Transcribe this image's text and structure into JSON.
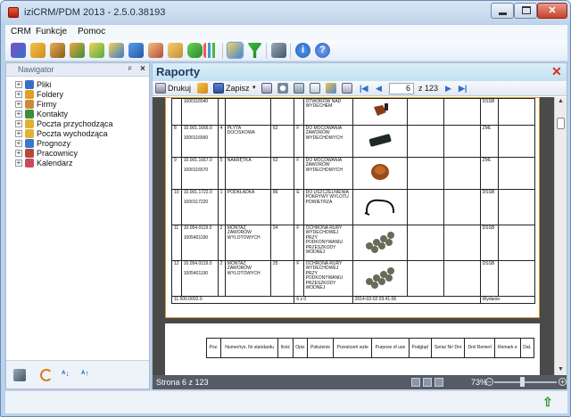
{
  "window": {
    "title": "iziCRM/PDM 2013 - 2.5.0.38193",
    "controls": {
      "minimize": "–",
      "maximize": "□",
      "close": "✕"
    }
  },
  "menu": [
    "CRM",
    "Funkcje",
    "Pomoc"
  ],
  "navigator": {
    "title": "Nawigator",
    "pin": "ᵖ",
    "close": "×",
    "items": [
      {
        "label": "Pliki",
        "icon": "files-icon",
        "color": "#3a6fc6"
      },
      {
        "label": "Foldery",
        "icon": "folder-icon",
        "color": "#e0a020"
      },
      {
        "label": "Firmy",
        "icon": "company-icon",
        "color": "#c98a3a"
      },
      {
        "label": "Kontakty",
        "icon": "contacts-icon",
        "color": "#3a8f3a"
      },
      {
        "label": "Poczta przychodząca",
        "icon": "inbox-icon",
        "color": "#e3b234"
      },
      {
        "label": "Poczta wychodząca",
        "icon": "outbox-icon",
        "color": "#e3b234"
      },
      {
        "label": "Prognozy",
        "icon": "forecast-icon",
        "color": "#3a78c9"
      },
      {
        "label": "Pracownicy",
        "icon": "employees-icon",
        "color": "#b34a3a"
      },
      {
        "label": "Kalendarz",
        "icon": "calendar-icon",
        "color": "#c94a5a"
      }
    ]
  },
  "report": {
    "title": "Raporty",
    "toolbar": {
      "print": "Drukuj",
      "save": "Zapisz",
      "page": "6",
      "of_pages": "z 123"
    },
    "status": "Strona 6 z 123",
    "zoom": "73%"
  },
  "report_table": {
    "rows": [
      {
        "lp": "",
        "nr": "1000116540",
        "qty": "",
        "name": "",
        "a": "",
        "b": "",
        "desc": "OTWORÓW NAD WYDECHEM",
        "img": "part-1",
        "status": "DSSB"
      },
      {
        "lp": "8",
        "nr": "10.001.1666.0\n\n1000116560",
        "qty": "4",
        "name": "PŁYTA DOCISKOWA",
        "a": "62",
        "b": "F",
        "desc": "DO MOCOWANIA ZAWORÓW WYDECHOWYCH",
        "img": "part-2",
        "status": "ZML"
      },
      {
        "lp": "9",
        "nr": "10.001.1667.0\n\n1000116570",
        "qty": "5",
        "name": "NAKRĘTKA",
        "a": "62",
        "b": "F",
        "desc": "DO MOCOWANIA ZAWORÓW WYDECHOWYCH",
        "img": "part-3",
        "status": "ZML"
      },
      {
        "lp": "10",
        "nr": "10.001.1722.0\n\n1000117220",
        "qty": "1",
        "name": "PODKŁADKA",
        "a": "86",
        "b": "E",
        "desc": "DO USZCZELNIENIA POKRYWY WYLOTU POWIETRZA",
        "img": "part-4",
        "status": "DSSB"
      },
      {
        "lp": "11",
        "nr": "10.054.0119.0\n\n1005401190",
        "qty": "2",
        "name": "MONTAŻ ZAWORÓW WYLOTOWYCH",
        "a": "24",
        "b": "F",
        "desc": "OCHRONA RURY WYDECHOWEJ PRZY PODKONYWANIU PRZESZKODY WODNEJ",
        "img": "part-5",
        "status": "DSSB"
      },
      {
        "lp": "12",
        "nr": "10.054.0119.0\n\n1005401190",
        "qty": "2",
        "name": "MONTAŻ ZAWORÓW WYLOTOWYCH",
        "a": "25",
        "b": "F",
        "desc": "OCHRONA RURY WYDECHOWEJ PRZY PODKONYWANIU PRZESZKODY WODNEJ",
        "img": "part-6",
        "status": "DSSB"
      }
    ],
    "footer": {
      "left": "11.500.0002.0",
      "mid": "6 z 0",
      "date": "2014-03-02 09:41:06",
      "right": "Wydanie:"
    },
    "next_page_header": [
      "Poz.",
      "Numer/rys. Nr standardu",
      "Ilość",
      "Opis",
      "Położenie",
      "Przestrzeń wzle",
      "Purpose of use",
      "Podgląd",
      "Seria/ Nr/ Dni",
      "Dni/ Remerl",
      "Remark e",
      "Dat."
    ]
  }
}
